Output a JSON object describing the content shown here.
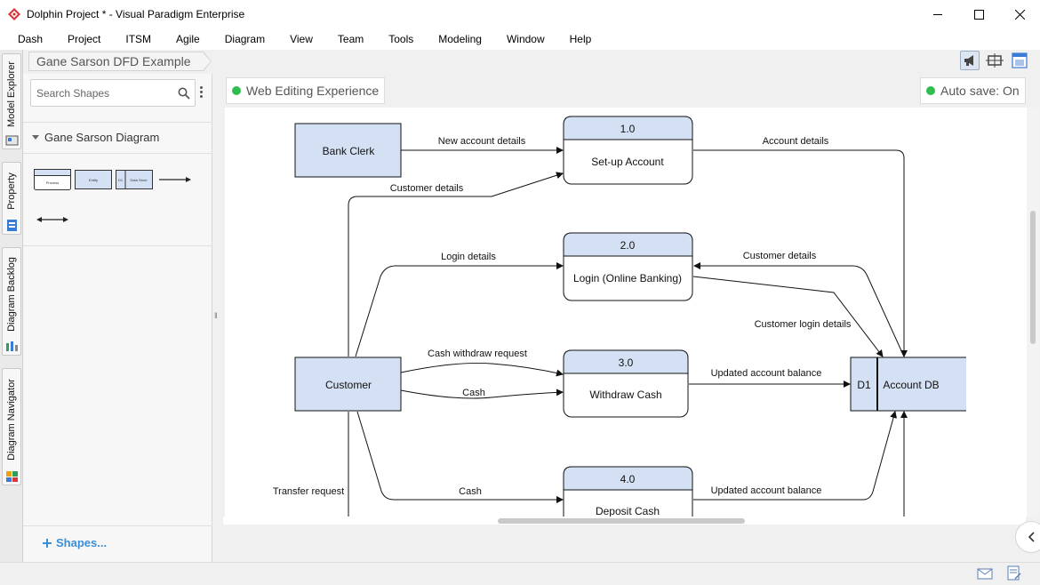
{
  "window": {
    "title": "Dolphin Project * - Visual Paradigm Enterprise",
    "controls": [
      "minimize",
      "maximize",
      "close"
    ]
  },
  "menu": [
    "Dash",
    "Project",
    "ITSM",
    "Agile",
    "Diagram",
    "View",
    "Team",
    "Tools",
    "Modeling",
    "Window",
    "Help"
  ],
  "side_tabs": [
    {
      "label": "Model Explorer",
      "icon": "model-explorer-icon"
    },
    {
      "label": "Property",
      "icon": "property-icon"
    },
    {
      "label": "Diagram Backlog",
      "icon": "backlog-icon"
    },
    {
      "label": "Diagram Navigator",
      "icon": "navigator-icon"
    }
  ],
  "breadcrumb": {
    "diagram_name": "Gane Sarson DFD Example"
  },
  "shapes_panel": {
    "search_placeholder": "Search Shapes",
    "group_title": "Gane Sarson Diagram",
    "thumb_data_store_id": "D1",
    "thumb_data_store_name": "Data Store",
    "thumb_entity": "Entity",
    "thumb_process": "Process",
    "add_shapes_label": "Shapes..."
  },
  "editor": {
    "web_editing_label": "Web Editing Experience",
    "autosave_label": "Auto save: On"
  },
  "diagram": {
    "entities": {
      "bank_clerk": "Bank Clerk",
      "customer": "Customer"
    },
    "processes": {
      "p1": {
        "id": "1.0",
        "name": "Set-up Account"
      },
      "p2": {
        "id": "2.0",
        "name": "Login (Online Banking)"
      },
      "p3": {
        "id": "3.0",
        "name": "Withdraw Cash"
      },
      "p4": {
        "id": "4.0",
        "name": "Deposit Cash"
      }
    },
    "data_store": {
      "id": "D1",
      "name": "Account DB"
    },
    "flows": {
      "new_account_details": "New account details",
      "account_details": "Account details",
      "customer_details_1": "Customer details",
      "login_details": "Login details",
      "customer_details_2": "Customer details",
      "customer_login_details": "Customer login details",
      "cash_withdraw_request": "Cash withdraw request",
      "cash_1": "Cash",
      "updated_balance_1": "Updated account balance",
      "transfer_request": "Transfer request",
      "cash_2": "Cash",
      "updated_balance_2": "Updated account balance"
    }
  },
  "colors": {
    "shape_fill": "#d4e1f5",
    "status_green": "#2ebd4e",
    "link_blue": "#3a8fd9"
  }
}
